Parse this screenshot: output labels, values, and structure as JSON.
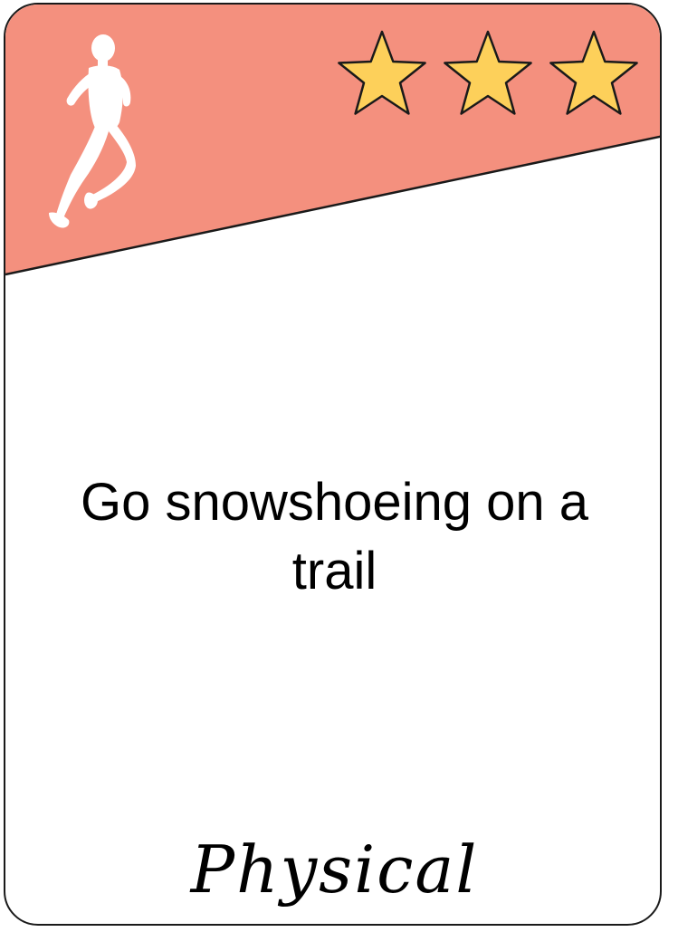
{
  "card": {
    "challenge_text": "Go snowshoeing on a trail",
    "category_label": "Physical",
    "rating_stars": 3,
    "rating_max": 3,
    "category_icon": "running-person-icon",
    "colors": {
      "banner": "#f4907e",
      "star_fill": "#fdd05a",
      "outline": "#1a1a1a",
      "runner": "#ffffff"
    }
  }
}
